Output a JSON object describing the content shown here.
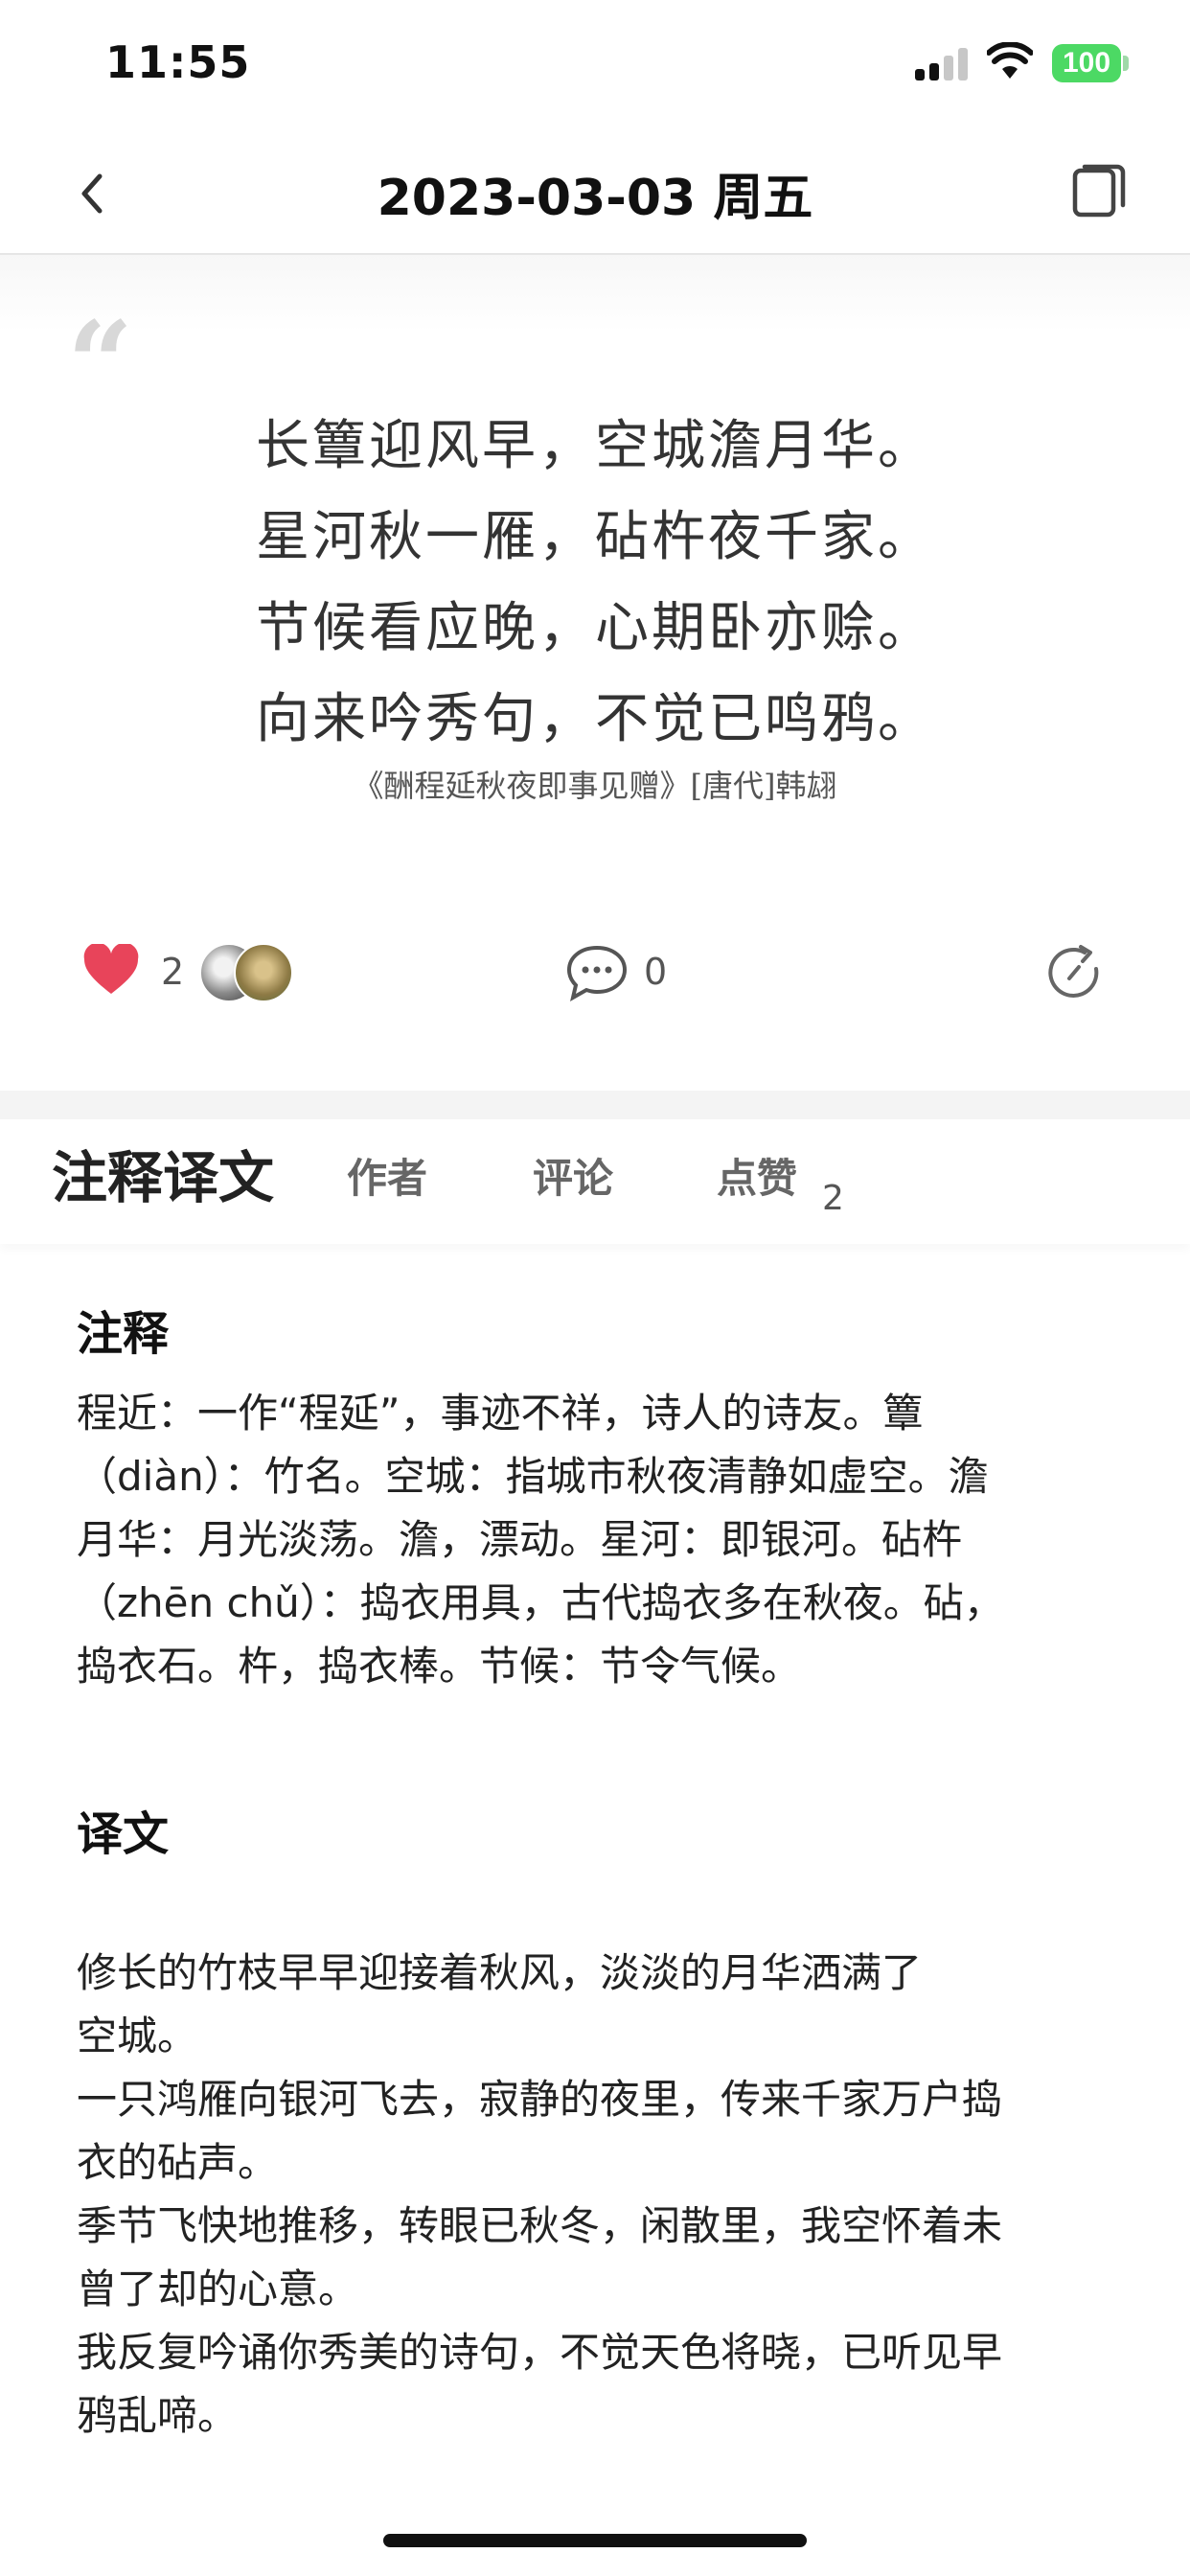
{
  "status_bar": {
    "time": "11:55",
    "battery": "100"
  },
  "nav": {
    "title": "2023-03-03 周五"
  },
  "poem": {
    "quote_mark": "“",
    "lines": [
      "长簟迎风早，空城澹月华。",
      "星河秋一雁，砧杵夜千家。",
      "节候看应晚，心期卧亦赊。",
      "向来吟秀句，不觉已鸣鸦。"
    ],
    "source": "《酬程延秋夜即事见赠》[唐代]韩翃"
  },
  "actions": {
    "like_count": "2",
    "comment_count": "0"
  },
  "tabs": [
    {
      "label": "注释译文"
    },
    {
      "label": "作者"
    },
    {
      "label": "评论"
    },
    {
      "label": "点赞",
      "badge": "2"
    }
  ],
  "annotation": {
    "title": "注释",
    "lines": [
      "程近：一作“程延”，事迹不祥，诗人的诗友。簟",
      "（diàn）：竹名。空城：指城市秋夜清静如虚空。澹",
      "月华：月光淡荡。澹，漂动。星河：即银河。砧杵",
      "（zhēn chǔ）：捣衣用具，古代捣衣多在秋夜。砧，",
      "捣衣石。杵，捣衣棒。节候：节令气候。"
    ]
  },
  "translation": {
    "title": "译文",
    "lines": [
      "修长的竹枝早早迎接着秋风，淡淡的月华洒满了",
      "空城。",
      "一只鸿雁向银河飞去，寂静的夜里，传来千家万户捣",
      "衣的砧声。",
      "季节飞快地推移，转眼已秋冬，闲散里，我空怀着未",
      "曾了却的心意。",
      "我反复吟诵你秀美的诗句，不觉天色将晓，已听见早",
      "鸦乱啼。"
    ]
  },
  "colors": {
    "heart": "#e8445a",
    "battery": "#4cd964"
  }
}
